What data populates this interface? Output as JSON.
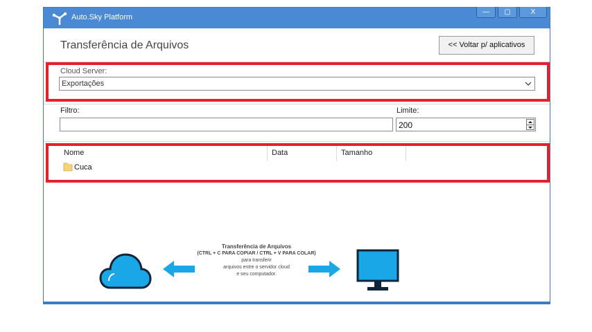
{
  "window": {
    "title": "Auto.Sky Platform",
    "buttons": {
      "minimize": "—",
      "maximize": "▢",
      "close": "X"
    }
  },
  "page": {
    "title": "Transferência de Arquivos",
    "back_button": "<< Voltar p/ aplicativos"
  },
  "cloud_server": {
    "label": "Cloud Server:",
    "selected": "Exportações"
  },
  "filters": {
    "filtro_label": "Filtro:",
    "filtro_value": "",
    "limite_label": "Limite:",
    "limite_value": "200"
  },
  "file_list": {
    "columns": [
      "Nome",
      "Data",
      "Tamanho"
    ],
    "rows": [
      {
        "name": "Cuca",
        "icon": "folder-icon"
      }
    ]
  },
  "info_panel": {
    "title": "Transferência de Arquivos",
    "shortcut": "(CTRL + C PARA COPIAR / CTRL + V PARA COLAR)",
    "line1": "para transferir",
    "line2": "arquivos entre o servidor cloud",
    "line3": "e seu computador."
  },
  "icons": [
    "app-logo-icon",
    "chevron-down-icon",
    "spinner-up-icon",
    "spinner-down-icon",
    "folder-icon",
    "cloud-icon",
    "arrow-left-icon",
    "arrow-right-icon",
    "monitor-icon"
  ],
  "colors": {
    "titlebar": "#4a8ad4",
    "highlight": "#e5202e",
    "illustration": "#1aa7e8"
  }
}
